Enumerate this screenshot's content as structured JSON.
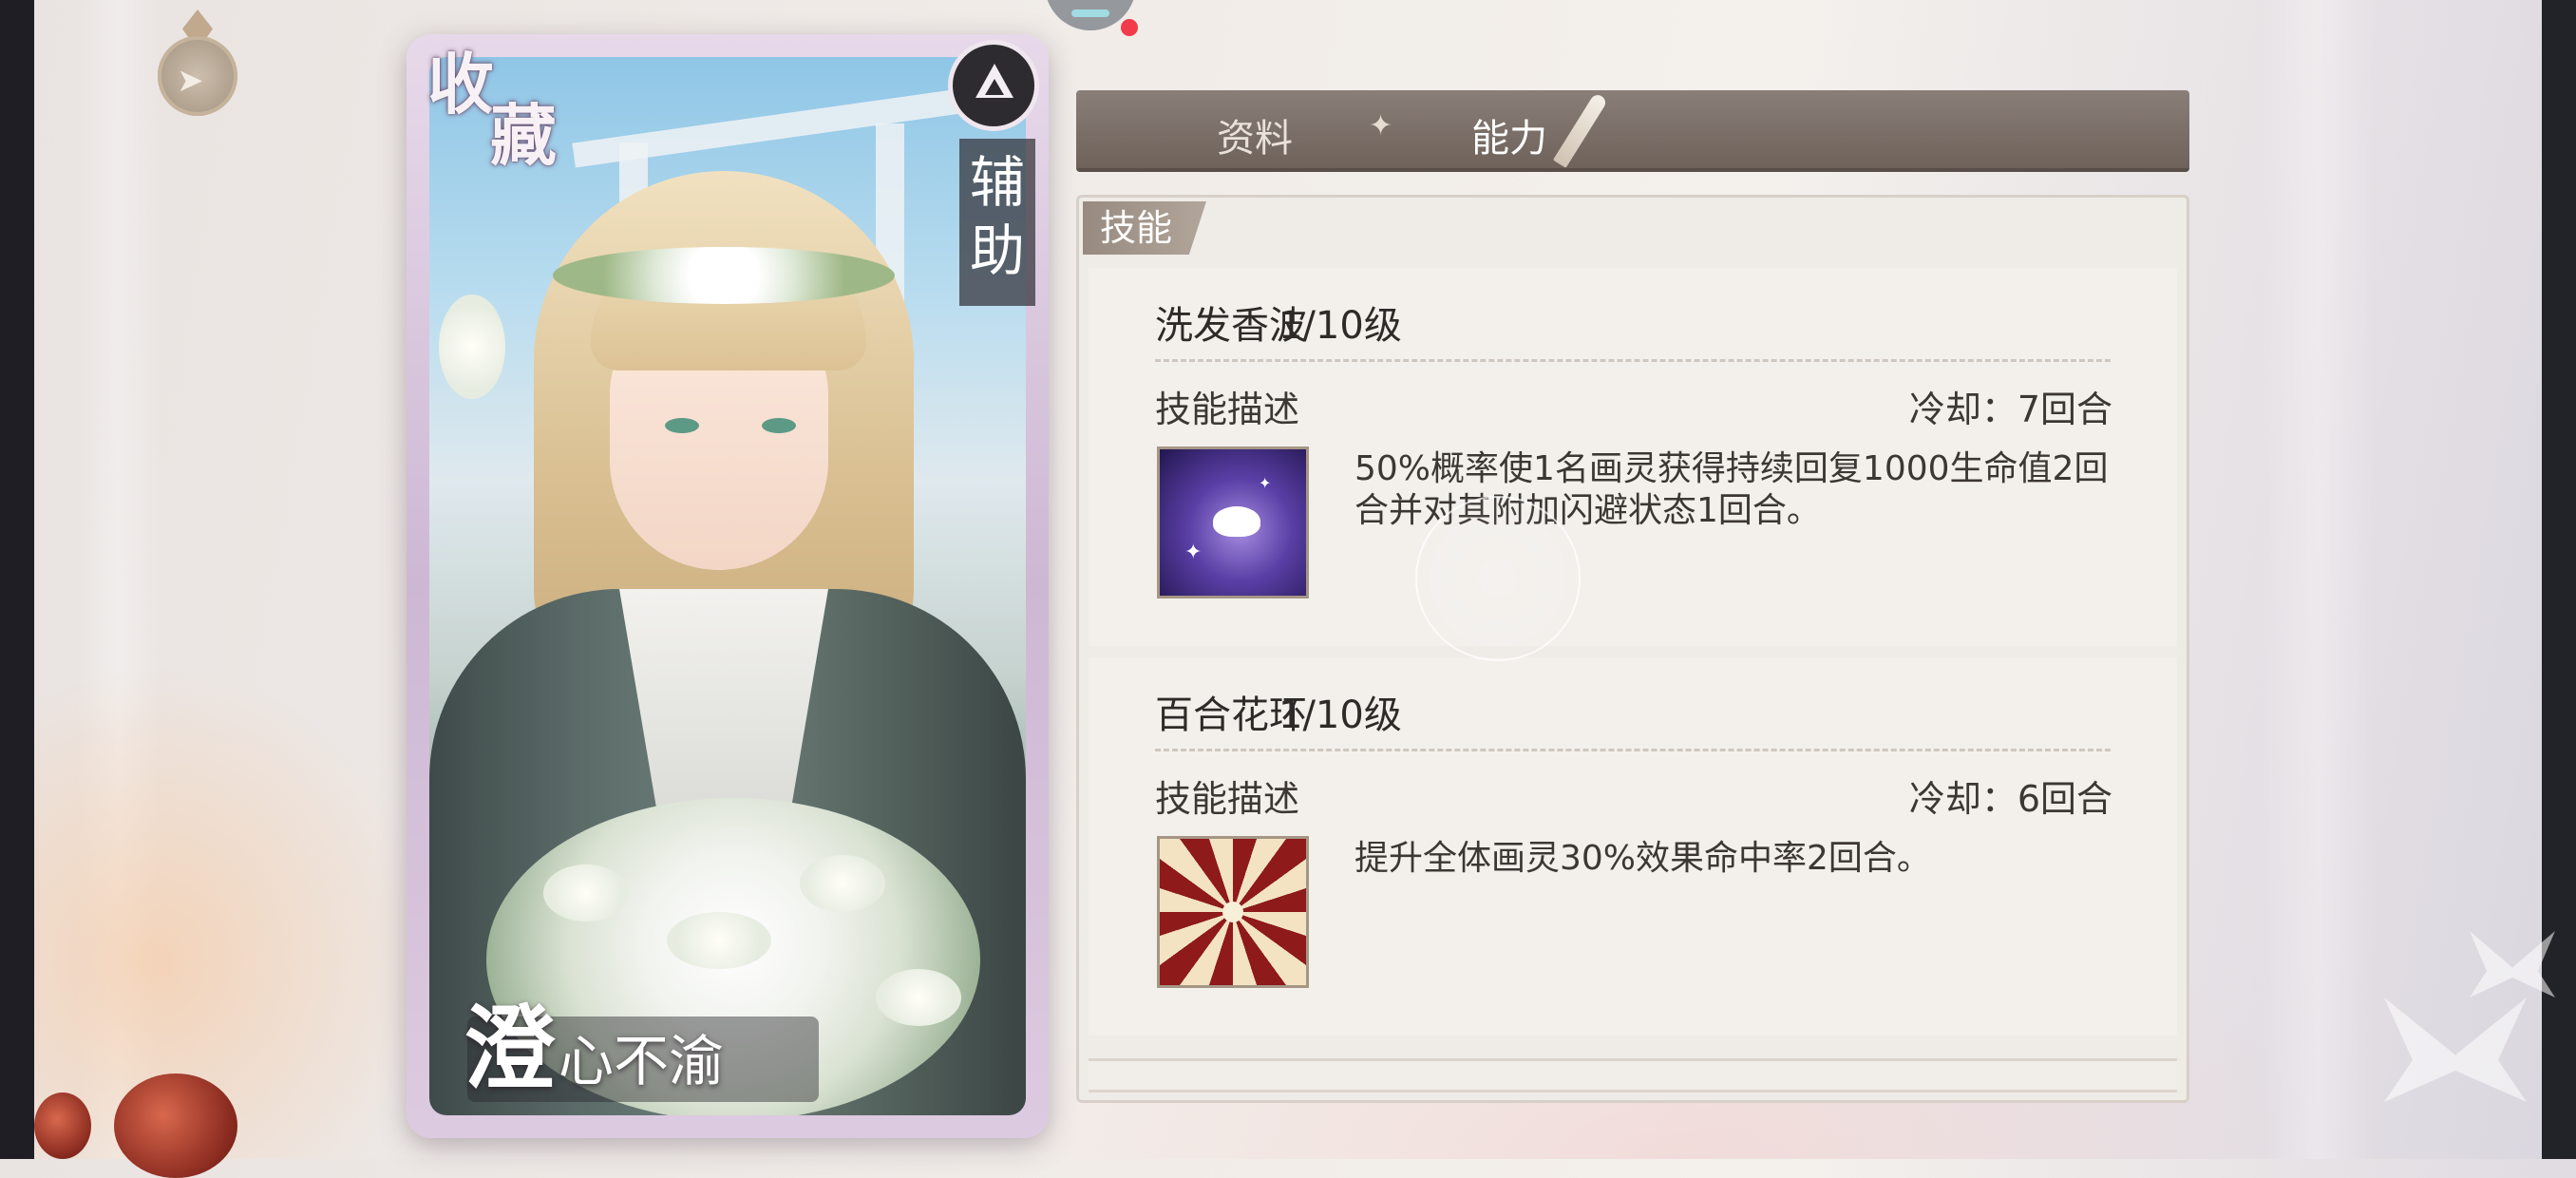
{
  "card": {
    "collect_label_1": "收",
    "collect_label_2": "藏",
    "type_icon": "support-triangle-icon",
    "type_label_1": "辅",
    "type_label_2": "助",
    "name_big": "澄",
    "name_small": "心不渝"
  },
  "tabs": [
    {
      "label": "资料",
      "active": false
    },
    {
      "label": "能力",
      "active": true
    }
  ],
  "tab_separator": "✦",
  "skills_panel": {
    "header": "技能",
    "skills": [
      {
        "name": "洗发香波",
        "level": "1/10级",
        "desc_label": "技能描述",
        "cooldown": "冷却：7回合",
        "icon": "cat-star-skill-icon",
        "description": "50%概率使1名画灵获得持续回复1000生命值2回合并对其附加闪避状态1回合。"
      },
      {
        "name": "百合花环",
        "level": "1/10级",
        "desc_label": "技能描述",
        "cooldown": "冷却：6回合",
        "icon": "swirl-burst-skill-icon",
        "description": "提升全体画灵30%效果命中率2回合。"
      }
    ]
  },
  "icons": {
    "back": "back-arrow-icon"
  },
  "colors": {
    "tab_bar": "#7a6e66",
    "panel_bg": "#efebe6",
    "notification_dot": "#f23b4a"
  }
}
